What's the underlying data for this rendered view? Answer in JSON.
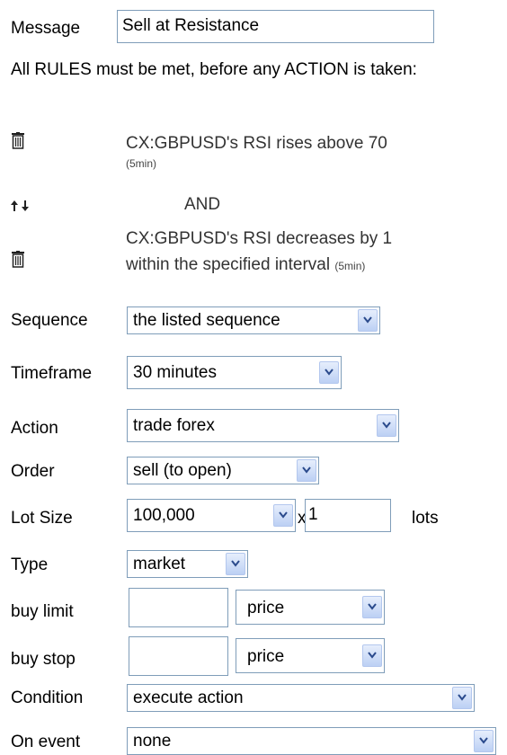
{
  "message": {
    "label": "Message",
    "value": "Sell at Resistance"
  },
  "notice": "All RULES must be met, before any ACTION is taken:",
  "rules": [
    {
      "text": "CX:GBPUSD's RSI rises above 70",
      "interval": "(5min)"
    },
    {
      "text_line1": "CX:GBPUSD's RSI decreases by 1",
      "text_line2": "within the specified interval",
      "interval": "(5min)"
    }
  ],
  "connector": "AND",
  "icons": {
    "delete": "trash-icon",
    "reorder": "up-down-arrows-icon",
    "dropdown": "chevron-down-icon"
  },
  "fields": {
    "sequence": {
      "label": "Sequence",
      "value": "the listed sequence"
    },
    "timeframe": {
      "label": "Timeframe",
      "value": "30 minutes"
    },
    "action": {
      "label": "Action",
      "value": "trade forex"
    },
    "order": {
      "label": "Order",
      "value": "sell (to open)"
    },
    "lot_size": {
      "label": "Lot Size",
      "value": "100,000",
      "multiplier": "x",
      "quantity": "1",
      "unit": "lots"
    },
    "type": {
      "label": "Type",
      "value": "market"
    },
    "buy_limit": {
      "label": "buy limit",
      "value": "",
      "mode": "price"
    },
    "buy_stop": {
      "label": "buy stop",
      "value": "",
      "mode": "price"
    },
    "condition": {
      "label": "Condition",
      "value": "execute action"
    },
    "on_event": {
      "label": "On event",
      "value": "none"
    }
  }
}
